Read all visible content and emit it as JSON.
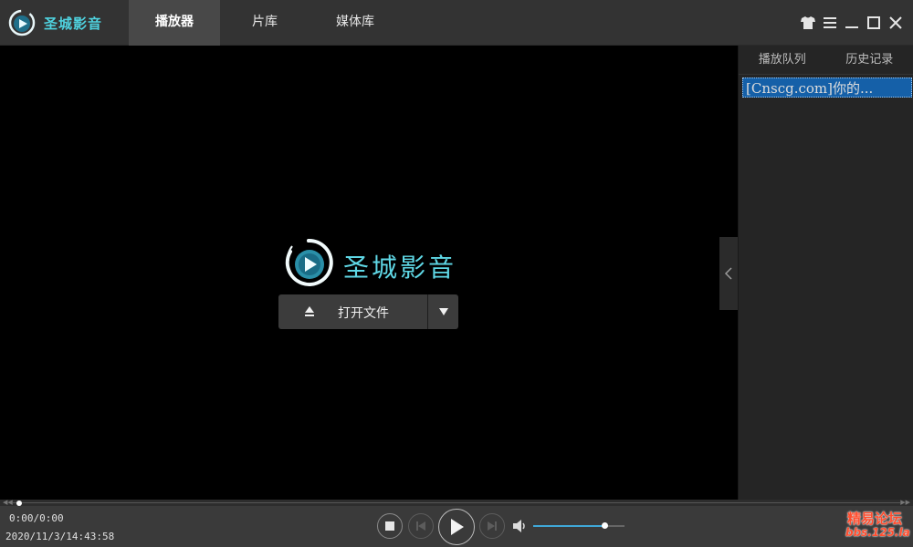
{
  "app": {
    "title": "圣城影音"
  },
  "tabs": [
    {
      "label": "播放器",
      "active": true
    },
    {
      "label": "片库",
      "active": false
    },
    {
      "label": "媒体库",
      "active": false
    }
  ],
  "window_controls": [
    "shirt-icon",
    "menu-icon",
    "minimize-icon",
    "maximize-icon",
    "close-icon"
  ],
  "player": {
    "brand": "圣城影音",
    "open_label": "打开文件"
  },
  "side_panel": {
    "tabs": [
      "播放队列",
      "历史记录"
    ],
    "playlist": [
      "[Cnscg.com]你的..."
    ]
  },
  "controls": {
    "time": "0:00/0:00",
    "datetime": "2020/11/3/14:43:58",
    "progress": 0,
    "volume": 0.78
  },
  "watermark": {
    "line1": "精易论坛",
    "line2": "bbs.125.la"
  },
  "colors": {
    "accent": "#4fd3e0",
    "selection": "#1560a8",
    "volume": "#3fa8d8",
    "watermark": "#ff4d2e"
  }
}
